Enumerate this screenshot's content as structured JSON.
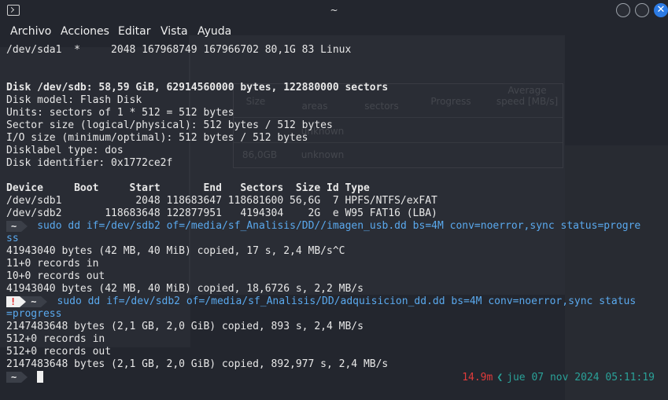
{
  "window": {
    "title": "~"
  },
  "menu": [
    "Archivo",
    "Acciones",
    "Editar",
    "Vista",
    "Ayuda"
  ],
  "background_window": {
    "columns": [
      "Size",
      "areas",
      "sectors",
      "Progress",
      "Average speed [MB/s]"
    ],
    "rows": [
      [
        "",
        "unknown"
      ],
      [
        "86,0GB",
        "unknown"
      ]
    ]
  },
  "terminal": {
    "lines": [
      {
        "text": "/dev/sda1  *     2048 167968749 167966702 80,1G 83 Linux"
      },
      {
        "text": ""
      },
      {
        "text": ""
      },
      {
        "text": "Disk /dev/sdb: 58,59 GiB, 62914560000 bytes, 122880000 sectors",
        "style": "bold"
      },
      {
        "text": "Disk model: Flash Disk"
      },
      {
        "text": "Units: sectors of 1 * 512 = 512 bytes"
      },
      {
        "text": "Sector size (logical/physical): 512 bytes / 512 bytes"
      },
      {
        "text": "I/O size (minimum/optimal): 512 bytes / 512 bytes"
      },
      {
        "text": "Disklabel type: dos"
      },
      {
        "text": "Disk identifier: 0x1772ce2f"
      },
      {
        "text": ""
      },
      {
        "text": "Device     Boot     Start       End   Sectors  Size Id Type",
        "style": "bold"
      },
      {
        "text": "/dev/sdb1            2048 118683647 118681600 56,6G  7 HPFS/NTFS/exFAT"
      },
      {
        "text": "/dev/sdb2       118683648 122877951   4194304    2G  e W95 FAT16 (LBA)"
      },
      {
        "prompt": "~",
        "cmd": "sudo dd if=/dev/sdb2 of=/media/sf_Analisis/DD//imagen_usb.dd bs=4M conv=noerror,sync status=progre"
      },
      {
        "text": "ss",
        "style": "cmd"
      },
      {
        "text": "41943040 bytes (42 MB, 40 MiB) copied, 17 s, 2,4 MB/s^C"
      },
      {
        "text": "11+0 records in"
      },
      {
        "text": "10+0 records out"
      },
      {
        "text": "41943040 bytes (42 MB, 40 MiB) copied, 18,6726 s, 2,2 MB/s"
      },
      {
        "prompt": "~",
        "error": "!",
        "cmd": "sudo dd if=/dev/sdb2 of=/media/sf_Analisis/DD/adquisicion_dd.dd bs=4M conv=noerror,sync status"
      },
      {
        "text": "=progress",
        "style": "cmd"
      },
      {
        "text": "2147483648 bytes (2,1 GB, 2,0 GiB) copied, 893 s, 2,4 MB/s"
      },
      {
        "text": "512+0 records in"
      },
      {
        "text": "512+0 records out"
      },
      {
        "text": "2147483648 bytes (2,1 GB, 2,0 GiB) copied, 892,977 s, 2,4 MB/s"
      },
      {
        "prompt": "~",
        "cursor": true
      }
    ],
    "right_prompt": {
      "duration": "14.9m",
      "datetime": "jue 07 nov 2024 05:11:19"
    }
  },
  "colors": {
    "background": "#23262e",
    "command": "#5aa9ee",
    "error": "#e02020",
    "datetime": "#2aa198",
    "close_button": "#2c7be5"
  }
}
